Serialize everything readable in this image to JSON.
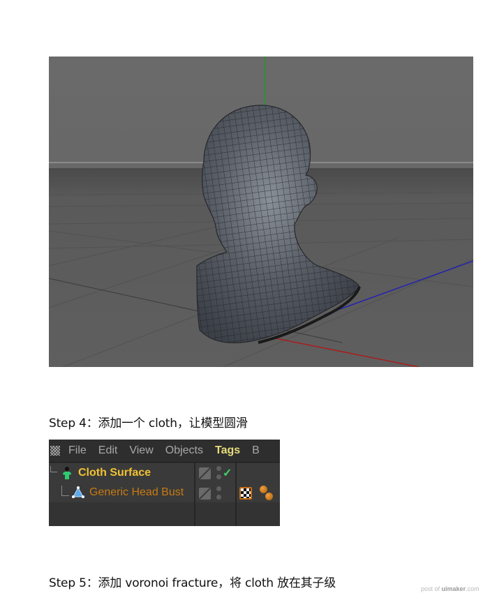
{
  "viewport": {
    "description": "Cinema 4D viewport showing a wireframe generic head bust",
    "colors": {
      "background": "#6b6b6b",
      "floor": "#5e5e5e",
      "y_axis": "#1f9a1f",
      "x_axis": "#a81e1e",
      "z_axis": "#2323b0",
      "mesh": "#4a4e55"
    }
  },
  "steps": [
    {
      "label": "Step 4：添加一个 cloth，让模型圆滑"
    },
    {
      "label": "Step 5：添加 voronoi fracture，将 cloth 放在其子级"
    }
  ],
  "object_manager": {
    "menu": [
      {
        "label": "File",
        "active": false
      },
      {
        "label": "Edit",
        "active": false
      },
      {
        "label": "View",
        "active": false
      },
      {
        "label": "Objects",
        "active": false
      },
      {
        "label": "Tags",
        "active": true
      },
      {
        "label": "B",
        "active": false
      }
    ],
    "objects": [
      {
        "name": "Cloth Surface",
        "icon": "cloth-surface-icon",
        "enabled_check": "✓",
        "color": "#f1c232"
      },
      {
        "name": "Generic Head Bust",
        "icon": "polygon-object-icon",
        "color": "#c77a12",
        "tags": [
          "material-tag-icon",
          "phong-tag-icon"
        ]
      }
    ]
  },
  "watermark": {
    "prefix": "post of ",
    "brand": "uimaker",
    "suffix": ".com"
  }
}
